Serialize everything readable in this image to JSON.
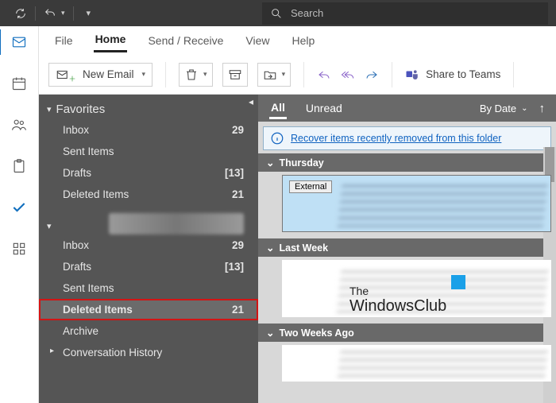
{
  "search": {
    "placeholder": "Search"
  },
  "tabs": {
    "file": "File",
    "home": "Home",
    "sendrecv": "Send / Receive",
    "view": "View",
    "help": "Help"
  },
  "ribbon": {
    "new_email": "New Email",
    "share_teams": "Share to Teams"
  },
  "favorites": {
    "header": "Favorites",
    "items": [
      {
        "label": "Inbox",
        "count": "29"
      },
      {
        "label": "Sent Items",
        "count": ""
      },
      {
        "label": "Drafts",
        "count": "[13]"
      },
      {
        "label": "Deleted Items",
        "count": "21"
      }
    ]
  },
  "account": {
    "items": [
      {
        "label": "Inbox",
        "count": "29"
      },
      {
        "label": "Drafts",
        "count": "[13]"
      },
      {
        "label": "Sent Items",
        "count": ""
      },
      {
        "label": "Deleted Items",
        "count": "21"
      },
      {
        "label": "Archive",
        "count": ""
      },
      {
        "label": "Conversation History",
        "count": ""
      }
    ]
  },
  "filter": {
    "all": "All",
    "unread": "Unread",
    "sort": "By Date"
  },
  "notice": {
    "text": "Recover items recently removed from this folder"
  },
  "groups": {
    "g0": "Thursday",
    "g1": "Last Week",
    "g2": "Two Weeks Ago"
  },
  "card0": {
    "external": "External"
  },
  "watermark": {
    "line1": "The",
    "line2": "WindowsClub"
  }
}
